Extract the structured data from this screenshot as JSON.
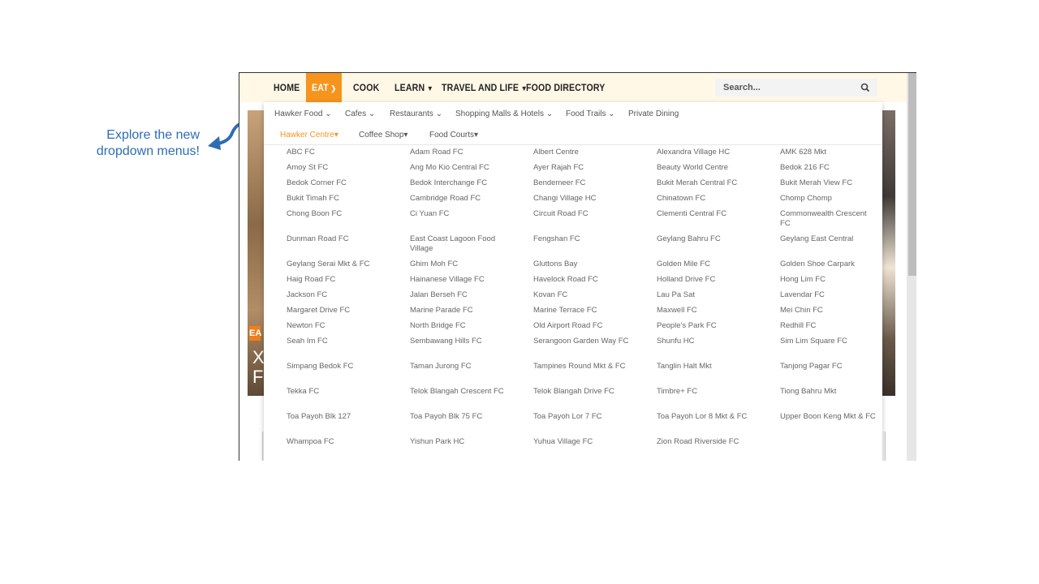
{
  "callout": {
    "line1": "Explore the new",
    "line2": "dropdown menus!"
  },
  "nav": {
    "items": [
      {
        "label": "HOME",
        "caret": false,
        "active": false
      },
      {
        "label": "EAT",
        "caret": true,
        "active": true
      },
      {
        "label": "COOK",
        "caret": false,
        "active": false
      },
      {
        "label": "LEARN",
        "caret": true,
        "active": false
      },
      {
        "label": "TRAVEL AND LIFE",
        "caret": true,
        "active": false
      },
      {
        "label": "FOOD DIRECTORY",
        "caret": false,
        "active": false
      }
    ],
    "search_placeholder": "Search...",
    "search_icon": "search-icon"
  },
  "submenu1": [
    {
      "label": "Hawker Food",
      "caret": true
    },
    {
      "label": "Cafes",
      "caret": true
    },
    {
      "label": "Restaurants",
      "caret": true
    },
    {
      "label": "Shopping Malls & Hotels",
      "caret": true
    },
    {
      "label": "Food Trails",
      "caret": true
    },
    {
      "label": "Private Dining",
      "caret": false
    }
  ],
  "submenu2": [
    {
      "label": "Hawker Centre",
      "active": true
    },
    {
      "label": "Coffee Shop",
      "active": false
    },
    {
      "label": "Food Courts",
      "active": false
    }
  ],
  "hawker_centres": [
    [
      "ABC FC",
      "Adam Road FC",
      "Albert Centre",
      "Alexandra Village HC",
      "AMK 628 Mkt"
    ],
    [
      "Amoy St FC",
      "Ang Mo Kio Central FC",
      "Ayer Rajah FC",
      "Beauty World Centre",
      "Bedok 216 FC"
    ],
    [
      "Bedok Corner FC",
      "Bedok Interchange FC",
      "Bendemeer FC",
      "Bukit Merah Central FC",
      "Bukit Merah View FC"
    ],
    [
      "Bukit Timah FC",
      "Cambridge Road FC",
      "Changi Village HC",
      "Chinatown FC",
      "Chomp Chomp"
    ],
    [
      "Chong Boon FC",
      "Ci Yuan FC",
      "Circuit Road FC",
      "Clementi Central FC",
      "Commonwealth Crescent FC"
    ],
    [
      "Dunman Road FC",
      "East Coast Lagoon Food Village",
      "Fengshan FC",
      "Geylang Bahru FC",
      "Geylang East Central"
    ],
    [
      "Geylang Serai Mkt & FC",
      "Ghim Moh FC",
      "Gluttons Bay",
      "Golden Mile FC",
      "Golden Shoe Carpark"
    ],
    [
      "Haig Road FC",
      "Hainanese Village FC",
      "Havelock Road FC",
      "Holland Drive FC",
      "Hong Lim FC"
    ],
    [
      "Jackson FC",
      "Jalan Berseh FC",
      "Kovan FC",
      "Lau Pa Sat",
      "Lavendar FC"
    ],
    [
      "Margaret Drive FC",
      "Marine Parade FC",
      "Marine Terrace FC",
      "Maxwell FC",
      "Mei Chin FC"
    ],
    [
      "Newton FC",
      "North Bridge FC",
      "Old Airport Road FC",
      "People's Park FC",
      "Redhill FC"
    ],
    [
      "Seah Im FC",
      "Sembawang Hills FC",
      "Serangoon Garden Way FC",
      "Shunfu HC",
      "Sim Lim Square FC"
    ],
    [
      "Simpang Bedok FC",
      "Taman Jurong FC",
      "Tampines Round Mkt & FC",
      "Tanglin Halt Mkt",
      "Tanjong Pagar FC"
    ],
    [
      "Tekka FC",
      "Telok Blangah Crescent FC",
      "Telok Blangah Drive FC",
      "Timbre+ FC",
      "Tiong Bahru Mkt"
    ],
    [
      "Toa Payoh Blk 127",
      "Toa Payoh Blk 75 FC",
      "Toa Payoh Lor 7 FC",
      "Toa Payoh Lor 8 Mkt & FC",
      "Upper Boon Keng Mkt & FC"
    ],
    [
      "Whampoa FC",
      "Yishun Park HC",
      "Yuhua Village FC",
      "Zion Road Riverside FC"
    ]
  ],
  "background": {
    "badge": "EA",
    "text1": "X",
    "text2": "F"
  },
  "colors": {
    "accent": "#f7941d",
    "callout": "#2e6db4",
    "nav_bg": "#fff8e6"
  }
}
